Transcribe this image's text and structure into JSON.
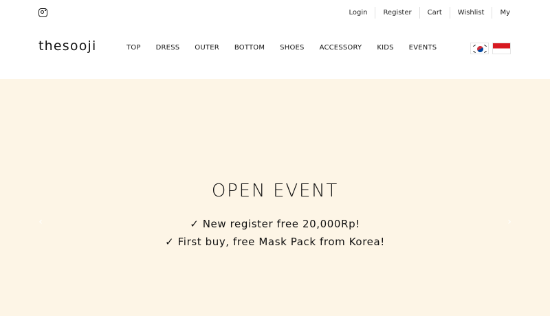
{
  "topbar": {
    "instagram_icon": "instagram-icon",
    "links": [
      "Login",
      "Register",
      "Cart",
      "Wishlist",
      "My"
    ]
  },
  "header": {
    "logo": "thesooji",
    "nav": [
      "TOP",
      "DRESS",
      "OUTER",
      "BOTTOM",
      "SHOES",
      "ACCESSORY",
      "KIDS",
      "EVENTS"
    ],
    "flags": [
      "korea-flag-icon",
      "indonesia-flag-icon"
    ]
  },
  "hero": {
    "title": "OPEN EVENT",
    "lines": [
      "✓ New register free 20,000Rp!",
      "✓ First buy, free Mask Pack from Korea!"
    ],
    "prev_icon": "chevron-left-icon",
    "next_icon": "chevron-right-icon"
  },
  "colors": {
    "hero_background": "#fdf5e6",
    "text": "#111111",
    "indonesia_red": "#d71920",
    "korea_red": "#cd2e3a",
    "korea_blue": "#0047a0"
  }
}
